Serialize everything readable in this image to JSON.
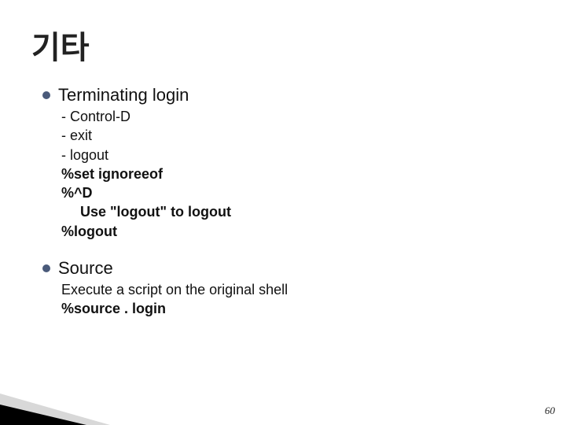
{
  "title": "기타",
  "b1": {
    "heading": "Terminating login",
    "l1": "- Control-D",
    "l2": "- exit",
    "l3": "- logout",
    "l4": "%set ignoreeof",
    "l5": "%^D",
    "l6": "Use \"logout\" to logout",
    "l7": "%logout"
  },
  "b2": {
    "heading": "Source",
    "l1": "Execute a script on the original shell",
    "l2": "%source . login"
  },
  "page_number": "60"
}
